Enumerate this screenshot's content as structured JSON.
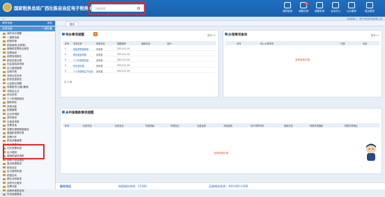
{
  "header": {
    "site_title": "国家税务总局广西壮族自治区电子税务局",
    "search_placeholder": "功能搜索",
    "nav": [
      {
        "label": "我的信息",
        "badge": ""
      },
      {
        "label": "我要办税",
        "badge": "1"
      },
      {
        "label": "我要查询",
        "badge": ""
      },
      {
        "label": "互动中心",
        "badge": ""
      },
      {
        "label": "公众服务",
        "badge": ""
      },
      {
        "label": "退出登录",
        "badge": ""
      }
    ],
    "strip_left": "1",
    "strip_right": "当前纳税人：南宁市某某科技有限公司"
  },
  "sidebar": {
    "header1": "我的功能",
    "header1_right": "添加",
    "header2": "全部功能",
    "header2_right": "一键折叠",
    "items": [
      "我的待办提醒",
      "一键零申报",
      "税费申报",
      "税费缴纳(含税款)",
      "增值税发票综合服务",
      "发票使用",
      "纳税信用报告",
      "税收优惠办理",
      "社会保险费申报",
      "出口退税管理",
      "证明开具",
      "涉税业务查询",
      "税务信息报告",
      "公益事业捐赠",
      "房屋租赁(出租)备案",
      "非居民企业",
      "综合查询",
      "个人所得税服务",
      "国际税收",
      "其他功能",
      "税源管理",
      "企业所得税",
      "资料报送",
      "社保费申报",
      "发票查询",
      "发票存根联数据报送",
      "增值税发票开具",
      "发票代开",
      "税控设备管理",
      "电子发票平台",
      "代开发票申请",
      "出口退税",
      "增值税留抵退税",
      "纳税人信息报告",
      "重点税源报送",
      "税收协定",
      "出口退税申报",
      "税银互动",
      "跨区涉税事项",
      "涉税专业服务",
      "发票作废",
      "纳税申报表查询",
      "外出经营报告"
    ]
  },
  "tabs": [
    {
      "label": "首页"
    }
  ],
  "todo_panel": {
    "title": "待办事项提醒",
    "count": "5",
    "more": "更多>>",
    "columns": [
      "序号",
      "事项名称",
      "申报状态",
      "提醒期限",
      "缴款状态",
      "操作"
    ],
    "rows": [
      {
        "no": "1",
        "name": "增值税预缴税款",
        "status": "未申报",
        "date": "2021-01-20"
      },
      {
        "no": "2",
        "name": "附加税费申报",
        "status": "未申报",
        "date": "2021-01-20"
      },
      {
        "no": "3",
        "name": "个人所得税扣缴",
        "status": "未申报",
        "date": "2021-01-20"
      },
      {
        "no": "4",
        "name": "印花税申报",
        "status": "未申报",
        "date": "2021-01-20"
      },
      {
        "no": "5",
        "name": "个人所得税生产经营",
        "status": "未申报",
        "date": "2021-01-20"
      }
    ],
    "footer": "共 5 条"
  },
  "notice_panel": {
    "title": "办理事项查询",
    "more": "更多>>",
    "columns": [
      "序号",
      "网上办理事项",
      "日期",
      "状态"
    ],
    "empty": "没有找到记录"
  },
  "bottom_panel": {
    "title": "未申报缴款事项提醒",
    "columns": [
      "序号",
      "征收项目",
      "征收品目",
      "所属期起",
      "所属期止",
      "应缴金额",
      "未缴金额",
      "电子税票号码",
      "缴款状态",
      "税款所属期起",
      "税款所属期止"
    ],
    "empty": "没有找到记录"
  },
  "footer": {
    "title": "服务电话",
    "tel_label": "纳税服务热线：12366",
    "tech_label": "运维服务热线：400-800-2366"
  }
}
